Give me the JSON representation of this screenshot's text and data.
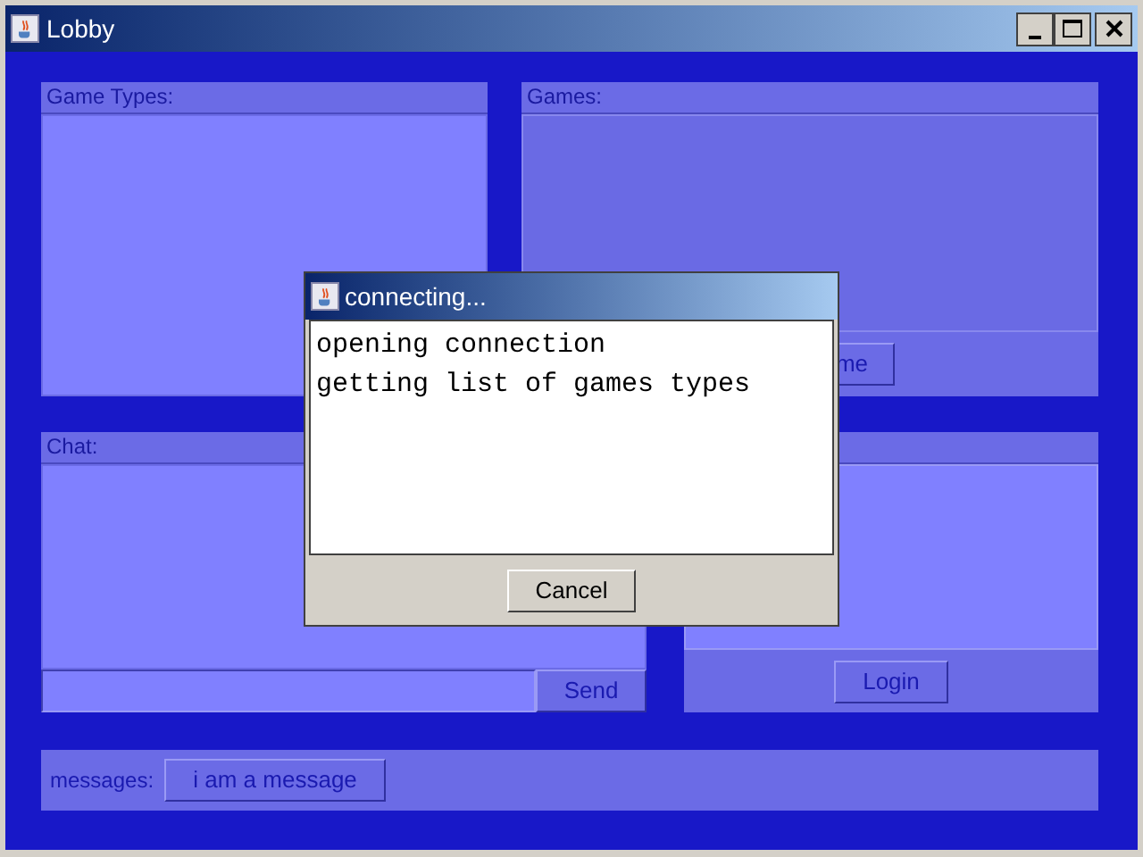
{
  "window": {
    "title": "Lobby"
  },
  "game_types": {
    "title": "Game Types:"
  },
  "games": {
    "title": "Games:",
    "button": "me"
  },
  "chat": {
    "title": "Chat:",
    "send_button": "Send"
  },
  "login_panel": {
    "button": "Login"
  },
  "messages": {
    "label": "messages:",
    "button": "i am a message"
  },
  "dialog": {
    "title": "connecting...",
    "lines": [
      "opening connection",
      "getting list of games types"
    ],
    "button": "Cancel"
  }
}
